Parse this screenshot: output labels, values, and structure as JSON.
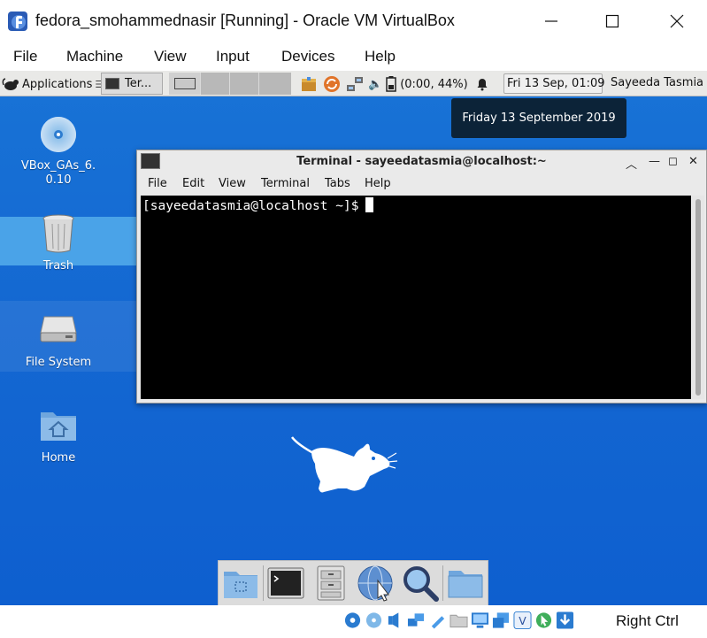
{
  "window": {
    "title": "fedora_smohammednasir [Running] - Oracle VM VirtualBox"
  },
  "host_menu": [
    "File",
    "Machine",
    "View",
    "Input",
    "Devices",
    "Help"
  ],
  "panel": {
    "applications_label": "Applications",
    "task_label": "Ter...",
    "battery_text": "(0:00, 44%)",
    "clock": "Fri 13 Sep, 01:09",
    "user": "Sayeeda Tasmia"
  },
  "tooltip": {
    "date": "Friday 13 September 2019"
  },
  "desktop_icons": [
    {
      "label": "VBox_GAs_6.\n0.10",
      "icon": "optical-disc-icon"
    },
    {
      "label": "Trash",
      "icon": "trash-icon"
    },
    {
      "label": "File System",
      "icon": "drive-icon"
    },
    {
      "label": "Home",
      "icon": "home-folder-icon"
    }
  ],
  "terminal": {
    "title": "Terminal - sayeedatasmia@localhost:~",
    "menu": [
      "File",
      "Edit",
      "View",
      "Terminal",
      "Tabs",
      "Help"
    ],
    "prompt": "[sayeedatasmia@localhost ~]$"
  },
  "dock_icons": [
    "show-desktop-icon",
    "terminal-icon",
    "file-manager-icon",
    "web-browser-icon",
    "search-icon",
    "folder-icon"
  ],
  "status": {
    "host_key": "Right Ctrl"
  },
  "colors": {
    "desktop": "#1468d2",
    "terminal_bg": "#000000",
    "tooltip_bg": "#0c2338"
  }
}
